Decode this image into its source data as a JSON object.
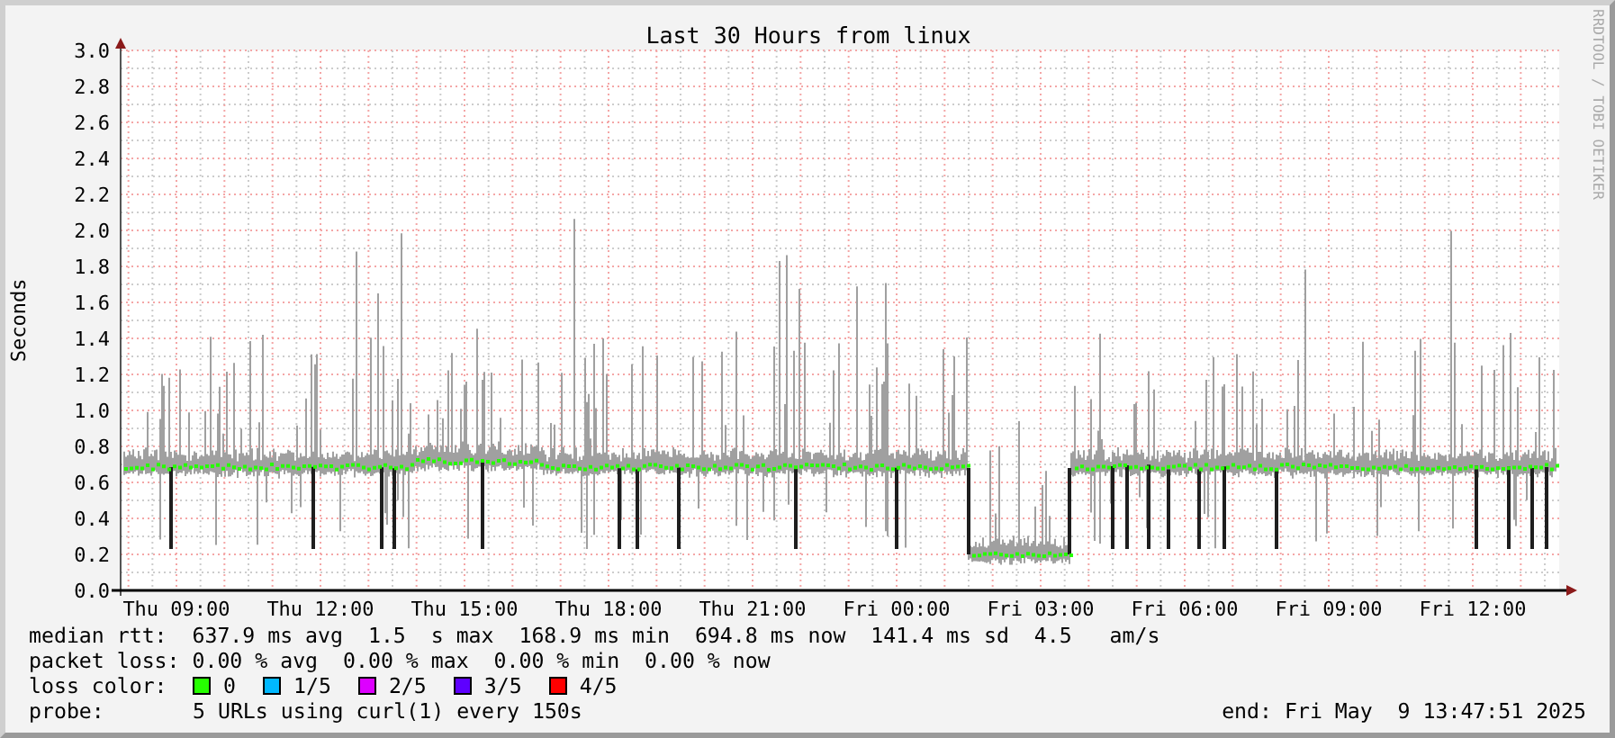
{
  "title": "Last 30 Hours from linux",
  "credit": "RRDTOOL / TOBI OETIKER",
  "y_axis": {
    "label": "Seconds",
    "ticks": [
      "3.0",
      "2.8",
      "2.6",
      "2.4",
      "2.2",
      "2.0",
      "1.8",
      "1.6",
      "1.4",
      "1.2",
      "1.0",
      "0.8",
      "0.6",
      "0.4",
      "0.2",
      "0.0"
    ]
  },
  "x_axis": {
    "ticks": [
      "Thu 09:00",
      "Thu 12:00",
      "Thu 15:00",
      "Thu 18:00",
      "Thu 21:00",
      "Fri 00:00",
      "Fri 03:00",
      "Fri 06:00",
      "Fri 09:00",
      "Fri 12:00"
    ]
  },
  "stats": [
    "median rtt:  637.9 ms avg  1.5  s max  168.9 ms min  694.8 ms now  141.4 ms sd  4.5   am/s",
    "packet loss: 0.00 % avg  0.00 % max  0.00 % min  0.00 % now"
  ],
  "loss_color": {
    "label": "loss color:",
    "items": [
      {
        "label": "0",
        "color": "#26ff00"
      },
      {
        "label": "1/5",
        "color": "#00b8ff"
      },
      {
        "label": "2/5",
        "color": "#dd00ff"
      },
      {
        "label": "3/5",
        "color": "#5e00ff"
      },
      {
        "label": "4/5",
        "color": "#ff0000"
      }
    ]
  },
  "probe": {
    "label": "probe:",
    "text": "5 URLs using curl(1) every 150s"
  },
  "end": "end: Fri May  9 13:47:51 2025"
}
